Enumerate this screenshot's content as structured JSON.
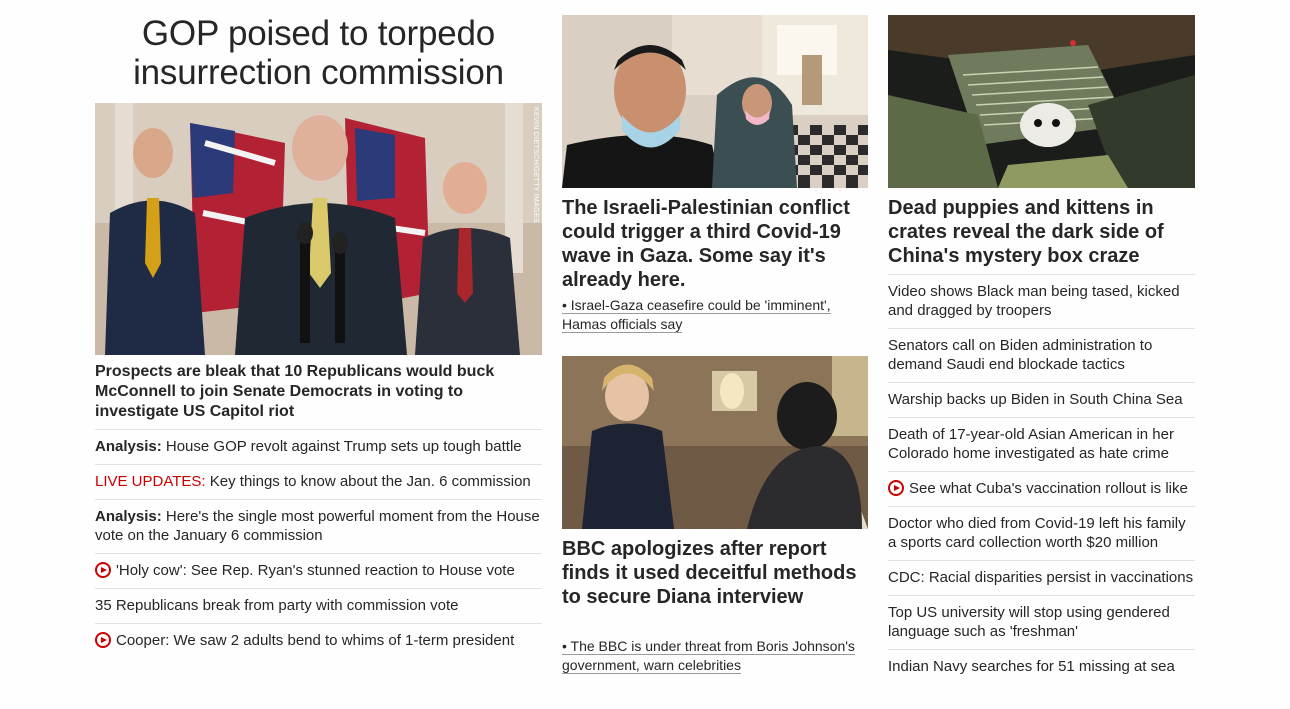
{
  "main": {
    "title": "GOP poised to torpedo insurrection commission",
    "image_credit": "KEVIN DIETSCH/GETTY IMAGES",
    "subhead": "Prospects are bleak that 10 Republicans would buck McConnell to join Senate Democrats in voting to investigate US Capitol riot",
    "items": [
      {
        "prefix": "Analysis:",
        "text": "House GOP revolt against Trump sets up tough battle"
      },
      {
        "prefix": "LIVE UPDATES:",
        "text": "Key things to know about the Jan. 6 commission"
      },
      {
        "prefix": "Analysis:",
        "text": "Here's the single most powerful moment from the House vote on the January 6 commission"
      },
      {
        "icon": "play-icon",
        "text": "'Holy cow': See Rep. Ryan's stunned reaction to House vote"
      },
      {
        "text": "35 Republicans break from party with commission vote"
      },
      {
        "icon": "play-icon",
        "text": "Cooper: We saw 2 adults bend to whims of 1-term president"
      }
    ]
  },
  "middle": {
    "story1": {
      "title": "The Israeli-Palestinian conflict could trigger a third Covid-19 wave in Gaza. Some say it's already here.",
      "link": "Israel-Gaza ceasefire could be 'imminent', Hamas officials say"
    },
    "story2": {
      "title": "BBC apologizes after report finds it used deceitful methods to secure Diana interview",
      "link": "The BBC is under threat from Boris Johnson's government, warn celebrities"
    }
  },
  "right": {
    "title": "Dead puppies and kittens in crates reveal the dark side of China's mystery box craze",
    "items": [
      {
        "text": "Video shows Black man being tased, kicked and dragged by troopers"
      },
      {
        "text": "Senators call on Biden administration to demand Saudi end blockade tactics"
      },
      {
        "text": "Warship backs up Biden in South China Sea"
      },
      {
        "text": "Death of 17-year-old Asian American in her Colorado home investigated as hate crime"
      },
      {
        "icon": "play-icon",
        "text": "See what Cuba's vaccination rollout is like"
      },
      {
        "text": "Doctor who died from Covid-19 left his family a sports card collection worth $20 million"
      },
      {
        "text": "CDC: Racial disparities persist in vaccinations"
      },
      {
        "text": "Top US university will stop using gendered language such as 'freshman'"
      },
      {
        "text": "Indian Navy searches for 51 missing at sea"
      }
    ]
  },
  "colors": {
    "accent": "#cc0000",
    "text": "#262626",
    "divider": "#e1e1e1"
  }
}
